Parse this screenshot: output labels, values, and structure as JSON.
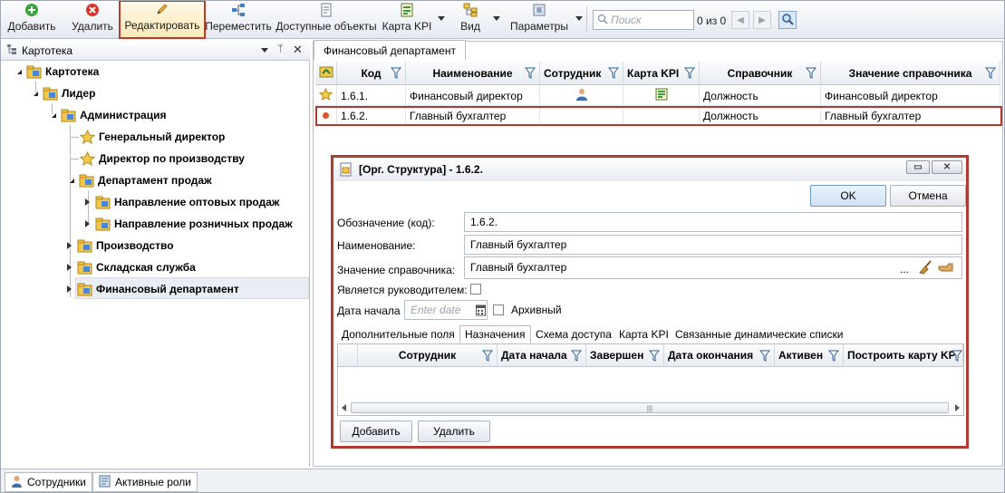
{
  "toolbar": {
    "add_label": "Добавить",
    "delete_label": "Удалить",
    "edit_label": "Редактировать",
    "move_label": "Переместить",
    "available_objects_label": "Доступные объекты",
    "kpi_map_label": "Карта KPI",
    "view_label": "Вид",
    "params_label": "Параметры",
    "search_placeholder": "Поиск",
    "counter": "0 из 0"
  },
  "left_panel": {
    "title": "Картотека",
    "tree": [
      {
        "label": "Картотека",
        "icon": "org-folder-icon"
      },
      {
        "label": "Лидер",
        "icon": "org-folder-icon"
      },
      {
        "label": "Администрация",
        "icon": "org-folder-icon"
      },
      {
        "label": "Генеральный директор",
        "icon": "star-icon"
      },
      {
        "label": "Директор по производству",
        "icon": "star-icon"
      },
      {
        "label": "Департамент продаж",
        "icon": "org-folder-icon"
      },
      {
        "label": "Направление оптовых продаж",
        "icon": "org-folder-icon"
      },
      {
        "label": "Направление розничных продаж",
        "icon": "org-folder-icon"
      },
      {
        "label": "Производство",
        "icon": "org-folder-icon"
      },
      {
        "label": "Складская служба",
        "icon": "org-folder-icon"
      },
      {
        "label": "Финансовый департамент",
        "icon": "org-folder-icon"
      }
    ]
  },
  "main": {
    "tab_label": "Финансовый департамент",
    "columns": [
      "Код",
      "Наименование",
      "Сотрудник",
      "Карта KPI",
      "Справочник",
      "Значение справочника"
    ],
    "rows": [
      {
        "code": "1.6.1.",
        "name": "Финансовый директор",
        "reference": "Должность",
        "reference_value": "Финансовый директор"
      },
      {
        "code": "1.6.2.",
        "name": "Главный бухгалтер",
        "reference": "Должность",
        "reference_value": "Главный бухгалтер"
      }
    ]
  },
  "dialog": {
    "title": "[Орг. Структура] - 1.6.2.",
    "ok_label": "OK",
    "cancel_label": "Отмена",
    "code_label": "Обозначение (код):",
    "code_value": "1.6.2.",
    "name_label": "Наименование:",
    "name_value": "Главный бухгалтер",
    "ref_value_label": "Значение справочника:",
    "ref_value": "Главный бухгалтер",
    "ref_dots": "...",
    "is_head_label": "Является руководителем:",
    "start_date_label": "Дата начала",
    "start_date_placeholder": "Enter date",
    "archived_label": "Архивный",
    "tabs": [
      "Дополнительные поля",
      "Назначения",
      "Схема доступа",
      "Карта KPI",
      "Связанные динамические списки"
    ],
    "sub_columns": [
      "Сотрудник",
      "Дата начала",
      "Завершен",
      "Дата окончания",
      "Активен",
      "Построить карту KPI"
    ],
    "add_label": "Добавить",
    "delete_label": "Удалить"
  },
  "bottom_tabs": [
    "Сотрудники",
    "Активные роли"
  ]
}
